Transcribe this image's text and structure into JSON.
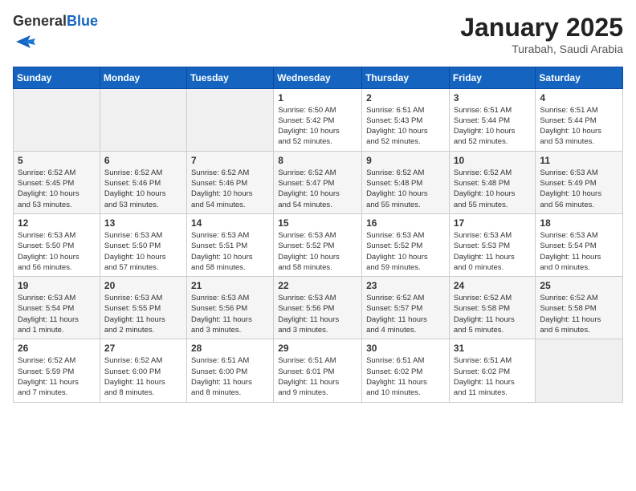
{
  "header": {
    "logo_general": "General",
    "logo_blue": "Blue",
    "month_title": "January 2025",
    "location": "Turabah, Saudi Arabia"
  },
  "weekdays": [
    "Sunday",
    "Monday",
    "Tuesday",
    "Wednesday",
    "Thursday",
    "Friday",
    "Saturday"
  ],
  "weeks": [
    [
      {
        "day": "",
        "info": ""
      },
      {
        "day": "",
        "info": ""
      },
      {
        "day": "",
        "info": ""
      },
      {
        "day": "1",
        "info": "Sunrise: 6:50 AM\nSunset: 5:42 PM\nDaylight: 10 hours\nand 52 minutes."
      },
      {
        "day": "2",
        "info": "Sunrise: 6:51 AM\nSunset: 5:43 PM\nDaylight: 10 hours\nand 52 minutes."
      },
      {
        "day": "3",
        "info": "Sunrise: 6:51 AM\nSunset: 5:44 PM\nDaylight: 10 hours\nand 52 minutes."
      },
      {
        "day": "4",
        "info": "Sunrise: 6:51 AM\nSunset: 5:44 PM\nDaylight: 10 hours\nand 53 minutes."
      }
    ],
    [
      {
        "day": "5",
        "info": "Sunrise: 6:52 AM\nSunset: 5:45 PM\nDaylight: 10 hours\nand 53 minutes."
      },
      {
        "day": "6",
        "info": "Sunrise: 6:52 AM\nSunset: 5:46 PM\nDaylight: 10 hours\nand 53 minutes."
      },
      {
        "day": "7",
        "info": "Sunrise: 6:52 AM\nSunset: 5:46 PM\nDaylight: 10 hours\nand 54 minutes."
      },
      {
        "day": "8",
        "info": "Sunrise: 6:52 AM\nSunset: 5:47 PM\nDaylight: 10 hours\nand 54 minutes."
      },
      {
        "day": "9",
        "info": "Sunrise: 6:52 AM\nSunset: 5:48 PM\nDaylight: 10 hours\nand 55 minutes."
      },
      {
        "day": "10",
        "info": "Sunrise: 6:52 AM\nSunset: 5:48 PM\nDaylight: 10 hours\nand 55 minutes."
      },
      {
        "day": "11",
        "info": "Sunrise: 6:53 AM\nSunset: 5:49 PM\nDaylight: 10 hours\nand 56 minutes."
      }
    ],
    [
      {
        "day": "12",
        "info": "Sunrise: 6:53 AM\nSunset: 5:50 PM\nDaylight: 10 hours\nand 56 minutes."
      },
      {
        "day": "13",
        "info": "Sunrise: 6:53 AM\nSunset: 5:50 PM\nDaylight: 10 hours\nand 57 minutes."
      },
      {
        "day": "14",
        "info": "Sunrise: 6:53 AM\nSunset: 5:51 PM\nDaylight: 10 hours\nand 58 minutes."
      },
      {
        "day": "15",
        "info": "Sunrise: 6:53 AM\nSunset: 5:52 PM\nDaylight: 10 hours\nand 58 minutes."
      },
      {
        "day": "16",
        "info": "Sunrise: 6:53 AM\nSunset: 5:52 PM\nDaylight: 10 hours\nand 59 minutes."
      },
      {
        "day": "17",
        "info": "Sunrise: 6:53 AM\nSunset: 5:53 PM\nDaylight: 11 hours\nand 0 minutes."
      },
      {
        "day": "18",
        "info": "Sunrise: 6:53 AM\nSunset: 5:54 PM\nDaylight: 11 hours\nand 0 minutes."
      }
    ],
    [
      {
        "day": "19",
        "info": "Sunrise: 6:53 AM\nSunset: 5:54 PM\nDaylight: 11 hours\nand 1 minute."
      },
      {
        "day": "20",
        "info": "Sunrise: 6:53 AM\nSunset: 5:55 PM\nDaylight: 11 hours\nand 2 minutes."
      },
      {
        "day": "21",
        "info": "Sunrise: 6:53 AM\nSunset: 5:56 PM\nDaylight: 11 hours\nand 3 minutes."
      },
      {
        "day": "22",
        "info": "Sunrise: 6:53 AM\nSunset: 5:56 PM\nDaylight: 11 hours\nand 3 minutes."
      },
      {
        "day": "23",
        "info": "Sunrise: 6:52 AM\nSunset: 5:57 PM\nDaylight: 11 hours\nand 4 minutes."
      },
      {
        "day": "24",
        "info": "Sunrise: 6:52 AM\nSunset: 5:58 PM\nDaylight: 11 hours\nand 5 minutes."
      },
      {
        "day": "25",
        "info": "Sunrise: 6:52 AM\nSunset: 5:58 PM\nDaylight: 11 hours\nand 6 minutes."
      }
    ],
    [
      {
        "day": "26",
        "info": "Sunrise: 6:52 AM\nSunset: 5:59 PM\nDaylight: 11 hours\nand 7 minutes."
      },
      {
        "day": "27",
        "info": "Sunrise: 6:52 AM\nSunset: 6:00 PM\nDaylight: 11 hours\nand 8 minutes."
      },
      {
        "day": "28",
        "info": "Sunrise: 6:51 AM\nSunset: 6:00 PM\nDaylight: 11 hours\nand 8 minutes."
      },
      {
        "day": "29",
        "info": "Sunrise: 6:51 AM\nSunset: 6:01 PM\nDaylight: 11 hours\nand 9 minutes."
      },
      {
        "day": "30",
        "info": "Sunrise: 6:51 AM\nSunset: 6:02 PM\nDaylight: 11 hours\nand 10 minutes."
      },
      {
        "day": "31",
        "info": "Sunrise: 6:51 AM\nSunset: 6:02 PM\nDaylight: 11 hours\nand 11 minutes."
      },
      {
        "day": "",
        "info": ""
      }
    ]
  ]
}
